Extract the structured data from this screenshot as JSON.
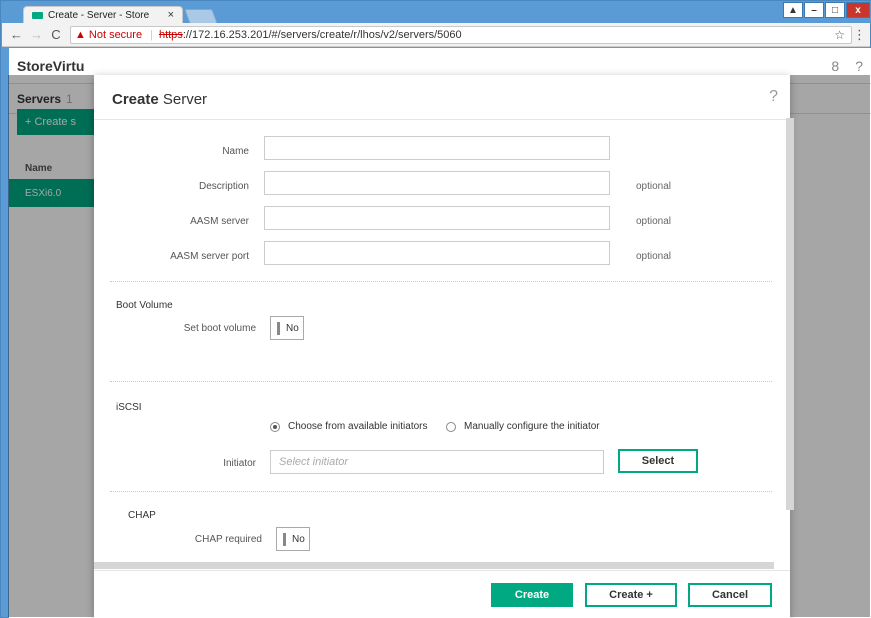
{
  "browser": {
    "tab_title": "Create - Server - Store",
    "tab_close": "×",
    "url_warning": "▲",
    "not_secure": "Not secure",
    "url_scheme": "https",
    "url_rest": "://172.16.253.201/#/servers/create/r/lhos/v2/servers/5060",
    "window_buttons": [
      "▲",
      "–",
      "□",
      "x"
    ]
  },
  "app": {
    "brand": "StoreVirtu",
    "section_title": "Servers",
    "section_count": "1",
    "create_button": "+ Create s",
    "column_name": "Name",
    "selected_row": "ESXi6.0"
  },
  "modal": {
    "title_bold": "Create",
    "title_rest": " Server",
    "help": "?",
    "fields": {
      "name_label": "Name",
      "description_label": "Description",
      "description_optional": "optional",
      "aasm_server_label": "AASM server",
      "aasm_server_optional": "optional",
      "aasm_port_label": "AASM server port",
      "aasm_port_optional": "optional"
    },
    "boot": {
      "section": "Boot Volume",
      "label": "Set boot volume",
      "value": "No"
    },
    "iscsi": {
      "section": "iSCSI",
      "radio_available": "Choose from available initiators",
      "radio_manual": "Manually configure the initiator",
      "initiator_label": "Initiator",
      "initiator_placeholder": "Select initiator",
      "select_button": "Select"
    },
    "chap": {
      "section": "CHAP",
      "label": "CHAP required",
      "value": "No"
    },
    "footer": {
      "create": "Create",
      "create_plus": "Create +",
      "cancel": "Cancel"
    }
  }
}
